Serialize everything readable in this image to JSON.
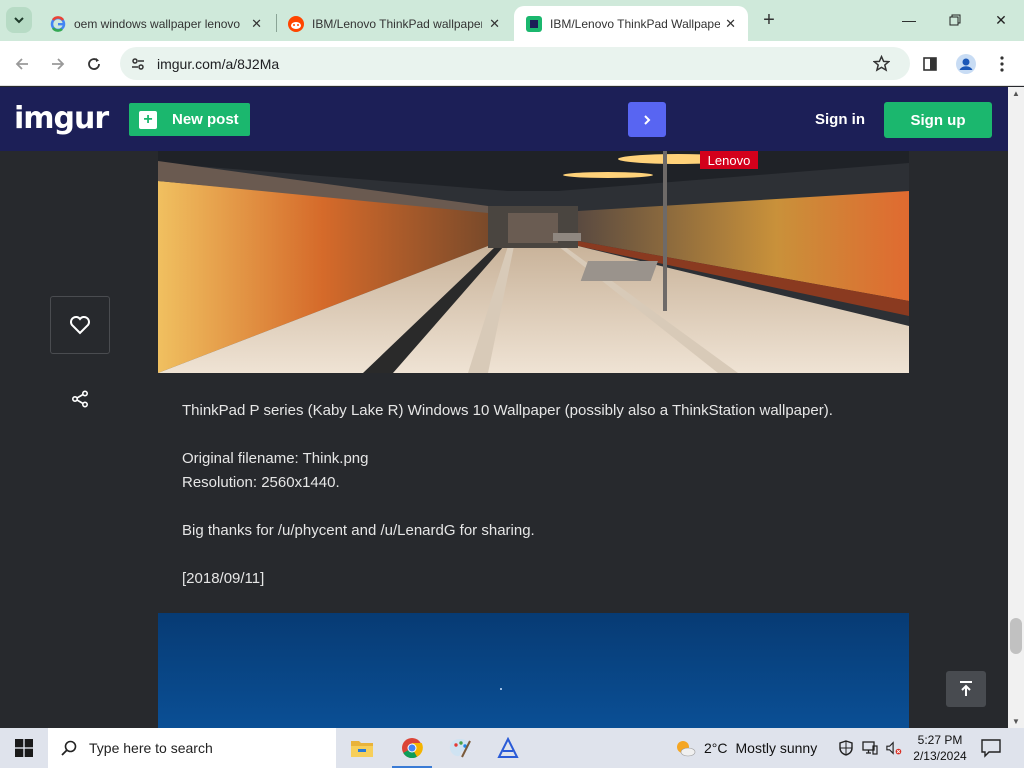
{
  "browser": {
    "tabs": [
      {
        "title": "oem windows wallpaper lenovo",
        "favicon": "google-icon",
        "active": false
      },
      {
        "title": "IBM/Lenovo ThinkPad wallpapers",
        "favicon": "reddit-icon",
        "active": false
      },
      {
        "title": "IBM/Lenovo ThinkPad Wallpapers",
        "favicon": "imgur-icon",
        "active": true
      }
    ],
    "url": "imgur.com/a/8J2Ma"
  },
  "header": {
    "logo": "imgur",
    "new_post": "New post",
    "sign_in": "Sign in",
    "sign_up": "Sign up"
  },
  "post": {
    "image_badge": "Lenovo",
    "description": [
      "ThinkPad P series (Kaby Lake R) Windows 10 Wallpaper (possibly also a ThinkStation wallpaper).",
      "Original filename: Think.png",
      "Resolution: 2560x1440.",
      "Big thanks for /u/phycent and /u/LenardG for sharing.",
      "[2018/09/11]"
    ]
  },
  "taskbar": {
    "search_placeholder": "Type here to search",
    "weather_temp": "2°C",
    "weather_desc": "Mostly sunny",
    "time": "5:27 PM",
    "date": "2/13/2024"
  },
  "colors": {
    "imgur_header": "#1c1f57",
    "imgur_green": "#1bb76e",
    "next_blue": "#5865f2",
    "page_bg": "#27292d",
    "tabstrip": "#cfe9da"
  }
}
